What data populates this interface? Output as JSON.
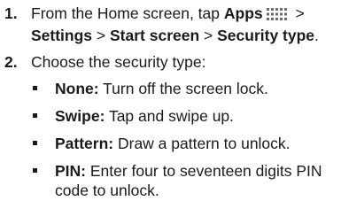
{
  "steps": [
    {
      "number": "1.",
      "intro": "From the Home screen, tap ",
      "apps_label": "Apps",
      "sep1": " > ",
      "settings_label": "Settings",
      "sep2": " > ",
      "start_screen_label": "Start screen",
      "sep3": " > ",
      "security_type_label": "Security type",
      "end": "."
    },
    {
      "number": "2.",
      "text": "Choose the security type:"
    }
  ],
  "options": [
    {
      "name": "None:",
      "desc": " Turn off the screen lock."
    },
    {
      "name": "Swipe:",
      "desc": " Tap and swipe up."
    },
    {
      "name": "Pattern:",
      "desc": " Draw a pattern to unlock."
    },
    {
      "name": "PIN:",
      "desc": " Enter four to seventeen digits PIN code to unlock."
    }
  ],
  "icons": {
    "apps": "apps-grid-icon",
    "bullet": "square-bullet"
  },
  "colors": {
    "text": "#1a1a1a",
    "icon": "#6b6b6b"
  }
}
